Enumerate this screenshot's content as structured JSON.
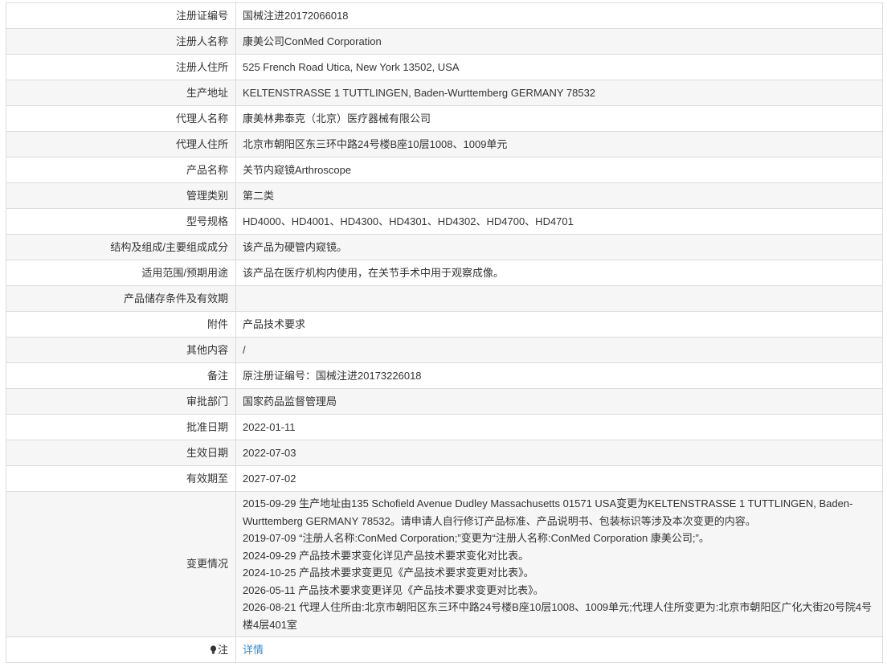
{
  "rows": [
    {
      "label": "注册证编号",
      "value": "国械注进20172066018"
    },
    {
      "label": "注册人名称",
      "value": "康美公司ConMed Corporation"
    },
    {
      "label": "注册人住所",
      "value": "525 French Road Utica, New York 13502, USA"
    },
    {
      "label": "生产地址",
      "value": "KELTENSTRASSE 1 TUTTLINGEN, Baden-Wurttemberg GERMANY 78532"
    },
    {
      "label": "代理人名称",
      "value": "康美林弗泰克（北京）医疗器械有限公司"
    },
    {
      "label": "代理人住所",
      "value": "北京市朝阳区东三环中路24号楼B座10层1008、1009单元"
    },
    {
      "label": "产品名称",
      "value": "关节内窥镜Arthroscope"
    },
    {
      "label": "管理类别",
      "value": "第二类"
    },
    {
      "label": "型号规格",
      "value": "HD4000、HD4001、HD4300、HD4301、HD4302、HD4700、HD4701"
    },
    {
      "label": "结构及组成/主要组成成分",
      "value": "该产品为硬管内窥镜。"
    },
    {
      "label": "适用范围/预期用途",
      "value": "该产品在医疗机构内使用，在关节手术中用于观察成像。"
    },
    {
      "label": "产品储存条件及有效期",
      "value": ""
    },
    {
      "label": "附件",
      "value": "产品技术要求"
    },
    {
      "label": "其他内容",
      "value": "/"
    },
    {
      "label": "备注",
      "value": "原注册证编号：国械注进20173226018"
    },
    {
      "label": "审批部门",
      "value": "国家药品监督管理局"
    },
    {
      "label": "批准日期",
      "value": "2022-01-11"
    },
    {
      "label": "生效日期",
      "value": "2022-07-03"
    },
    {
      "label": "有效期至",
      "value": "2027-07-02"
    }
  ],
  "changes": {
    "label": "变更情况",
    "lines": [
      "2015-09-29 生产地址由135 Schofield Avenue Dudley Massachusetts 01571 USA变更为KELTENSTRASSE 1 TUTTLINGEN, Baden-Wurttemberg GERMANY 78532。请申请人自行修订产品标准、产品说明书、包装标识等涉及本次变更的内容。",
      "2019-07-09 “注册人名称:ConMed Corporation;”变更为“注册人名称:ConMed Corporation 康美公司;”。",
      "2024-09-29 产品技术要求变化详见产品技术要求变化对比表。",
      "2024-10-25 产品技术要求变更见《产品技术要求变更对比表》。",
      "2026-05-11 产品技术要求变更详见《产品技术要求变更对比表》。",
      "2026-08-21 代理人住所由:北京市朝阳区东三环中路24号楼B座10层1008、1009单元;代理人住所变更为:北京市朝阳区广化大街20号院4号楼4层401室"
    ]
  },
  "note": {
    "label": "注",
    "icon": "lightbulb-icon",
    "link_text": "详情",
    "link_color": "#2d8cd8"
  }
}
